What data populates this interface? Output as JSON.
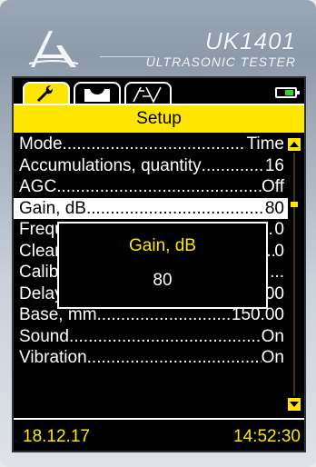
{
  "header": {
    "brand": "UK1401",
    "subtitle": "ULTRASONIC TESTER"
  },
  "tabs": [
    {
      "icon": "wrench-icon",
      "active": true
    },
    {
      "icon": "waveform-icon",
      "active": false
    },
    {
      "icon": "probe-angle-icon",
      "active": false
    }
  ],
  "battery": {
    "level": 0.35,
    "color": "#2dd22d"
  },
  "screen": {
    "title": "Setup"
  },
  "menu": {
    "items": [
      {
        "label": "Mode",
        "value": "Time"
      },
      {
        "label": "Accumulations, quantity",
        "value": "16"
      },
      {
        "label": "AGC",
        "value": "Off"
      },
      {
        "label": "Gain, dB",
        "value": "80"
      },
      {
        "label": "Frequency",
        "value": "0"
      },
      {
        "label": "Clear",
        "value": "0"
      },
      {
        "label": "Calibration",
        "value": "..."
      },
      {
        "label": "Delay, µs",
        "value": "0.00"
      },
      {
        "label": "Base, mm",
        "value": "150.00"
      },
      {
        "label": "Sound",
        "value": "On"
      },
      {
        "label": "Vibration",
        "value": "On"
      }
    ],
    "selected_index": 3
  },
  "popup": {
    "title": "Gain, dB",
    "value": "80"
  },
  "footer": {
    "date": "18.12.17",
    "time": "14:52:30"
  },
  "colors": {
    "accent": "#ffe600",
    "background": "#000000",
    "text": "#ffffff"
  }
}
